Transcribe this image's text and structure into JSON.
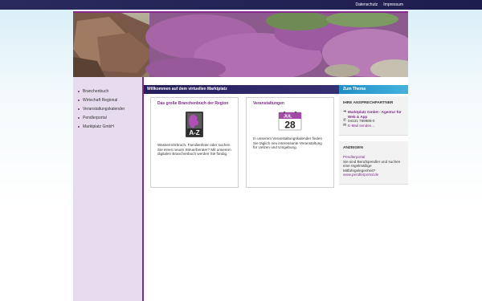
{
  "topnav": {
    "datenschutz": "Datenschutz",
    "impressum": "Impressum"
  },
  "sidebar": {
    "items": [
      {
        "label": "Branchenbuch"
      },
      {
        "label": "Wirtschaft Regional"
      },
      {
        "label": "Veranstaltungskalender"
      },
      {
        "label": "Pendlerportal"
      },
      {
        "label": "Marktplatz GmbH"
      }
    ]
  },
  "main": {
    "header": "Willkommen auf dem virtuellen Marktplatz",
    "cards": [
      {
        "title": "Das große Branchenbuch der Region",
        "icon": "a-z-directory-icon",
        "icon_text": "A-Z",
        "text": "Wasserrohrbruch, Familienfeier oder suchen Sie einen neuen Steuerberater? Mit unserem digitalen Branchenbuch werden Sie fündig."
      },
      {
        "title": "Veranstaltungen",
        "icon": "calendar-icon",
        "icon_month": "JUL",
        "icon_day": "28",
        "text": "In unserem Veranstaltungskalender finden Sie täglich neu interessante Veranstaltung für Uelzen und Umgebung."
      }
    ]
  },
  "right": {
    "header": "Zum Thema",
    "contact": {
      "heading": "IHRE ANSPRECHPARTNER",
      "company": "Marktplatz GmbH - Agentur für Web & App",
      "phone": "04131 789988-0",
      "email": "E-Mail senden..."
    },
    "ad": {
      "heading": "ANZEIGEN",
      "link": "Pendlerportal",
      "text": "Sie sind Berufspendler und suchen eine regelmäßige Mitfahrgelegenheit?",
      "url": "www.pendlerportal.de"
    }
  },
  "colors": {
    "topbar": "#1d1d4f",
    "accent_purple": "#7a2f86",
    "main_header": "#2b2566",
    "right_header": "#2fa0d3",
    "sidebar_bg": "#e6dcee"
  }
}
